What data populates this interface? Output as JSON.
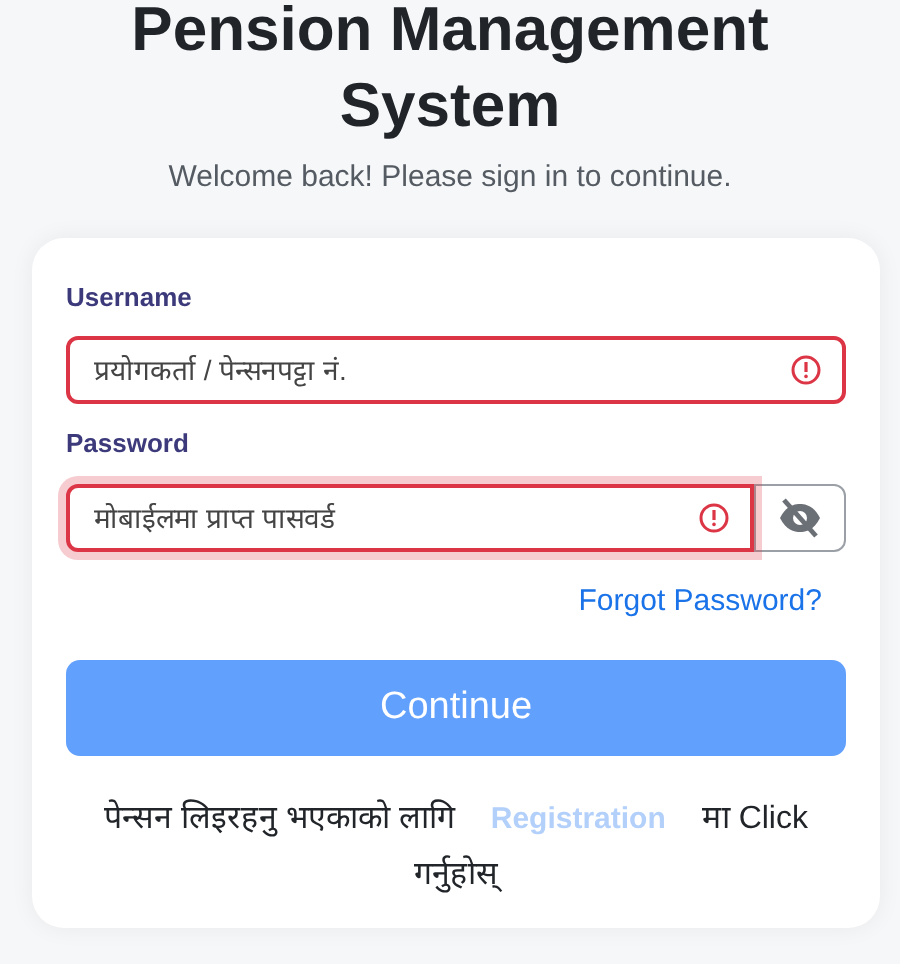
{
  "header": {
    "title": "Pension Management System",
    "subtitle": "Welcome back! Please sign in to continue."
  },
  "form": {
    "fields": [
      {
        "kind": "text",
        "label": "Username",
        "placeholder": "प्रयोगकर्ता / पेन्सनपट्टा नं.",
        "error": true,
        "focused": false
      },
      {
        "kind": "password",
        "label": "Password",
        "placeholder": "मोबाईलमा प्राप्त पासवर्ड",
        "error": true,
        "focused": true
      }
    ],
    "forgot_link": "Forgot Password?",
    "submit_button": {
      "label": "Continue",
      "disabled": true
    },
    "register_note": {
      "before": "पेन्सन लिइरहनु भएकाको लागि",
      "link": "Registration",
      "after": "मा Click गर्नुहोस्"
    }
  }
}
